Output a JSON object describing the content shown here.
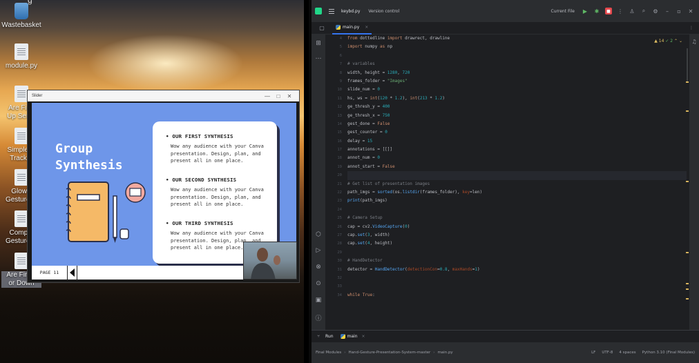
{
  "desktop": {
    "caption": "g",
    "icons": [
      {
        "label": "Wastebasket",
        "kind": "bin"
      },
      {
        "label": "module.py",
        "kind": "doc"
      },
      {
        "label": "Are Fing",
        "label2": "Up Servo",
        "kind": "doc"
      },
      {
        "label": "Simple-H",
        "label2": "Tracker",
        "kind": "doc"
      },
      {
        "label": "GlowB",
        "label2": "Gesture-C",
        "kind": "doc"
      },
      {
        "label": "Comput",
        "label2": "Gesture-C",
        "kind": "doc"
      },
      {
        "label": "Are Finge",
        "label2": "or Down",
        "kind": "doc"
      }
    ]
  },
  "viewer": {
    "title": "Slider",
    "controls": {
      "minimize": "—",
      "maximize": "□",
      "close": "✕"
    },
    "slide": {
      "heading_line1": "Group",
      "heading_line2": "Synthesis",
      "sections": [
        {
          "title": "OUR FIRST SYNTHESIS",
          "body1": "Wow any audience with your Canva",
          "body2": "presentation. Design, plan, and",
          "body3": "present all in one place."
        },
        {
          "title": "OUR SECOND SYNTHESIS",
          "body1": "Wow any audience with your Canva",
          "body2": "presentation. Design, plan, and",
          "body3": "present all in one place."
        },
        {
          "title": "OUR THIRD SYNTHESIS",
          "body1": "Wow any audience with your Canva",
          "body2": "presentation. Design, plan, and",
          "body3": "present all in one place."
        }
      ],
      "page_label": "PAGE 11"
    }
  },
  "ide": {
    "project": "keybd.py",
    "vcs": "Version control",
    "run_config": "Current File",
    "tab": "main.py",
    "inspections": {
      "warnings": "14",
      "ok": "2"
    },
    "lines": [
      "from dottedline import drawrect, drawline",
      "import numpy as np",
      "",
      "# variables",
      "width, height = 1280, 720",
      "frames_folder = \"Images\"",
      "slide_num = 0",
      "hs, ws = int(120 * 1.2), int(213 * 1.2)",
      "ge_thresh_y = 400",
      "ge_thresh_x = 750",
      "gest_done = False",
      "gest_counter = 0",
      "delay = 15",
      "annotations = [[]]",
      "annot_num = 0",
      "annot_start = False",
      "",
      "# Get list of presentation images",
      "path_imgs = sorted(os.listdir(frames_folder), key=len)",
      "print(path_imgs)",
      "",
      "# Camera Setup",
      "cap = cv2.VideoCapture(0)",
      "cap.set(3, width)",
      "cap.set(4, height)",
      "",
      "# HandDetector",
      "detector = HandDetector(detectionCon=0.8, maxHands=1)",
      "",
      "",
      "while True:"
    ],
    "line_numbers": [
      "4",
      "5",
      "6",
      "7",
      "8",
      "9",
      "10",
      "11",
      "12",
      "13",
      "14",
      "15",
      "16",
      "17",
      "18",
      "19",
      "20",
      "21",
      "22",
      "23",
      "24",
      "25",
      "26",
      "27",
      "28",
      "29",
      "30",
      "31",
      "32",
      "33",
      "34"
    ],
    "run_label": "Run",
    "run_tab": "main",
    "breadcrumb": [
      "Final Modules",
      "Hand-Gesture-Presentation-System-master",
      "main.py"
    ],
    "status_right": [
      "LF",
      "UTF-8",
      "4 spaces",
      "Python 3.10 (Final Modules)"
    ]
  }
}
